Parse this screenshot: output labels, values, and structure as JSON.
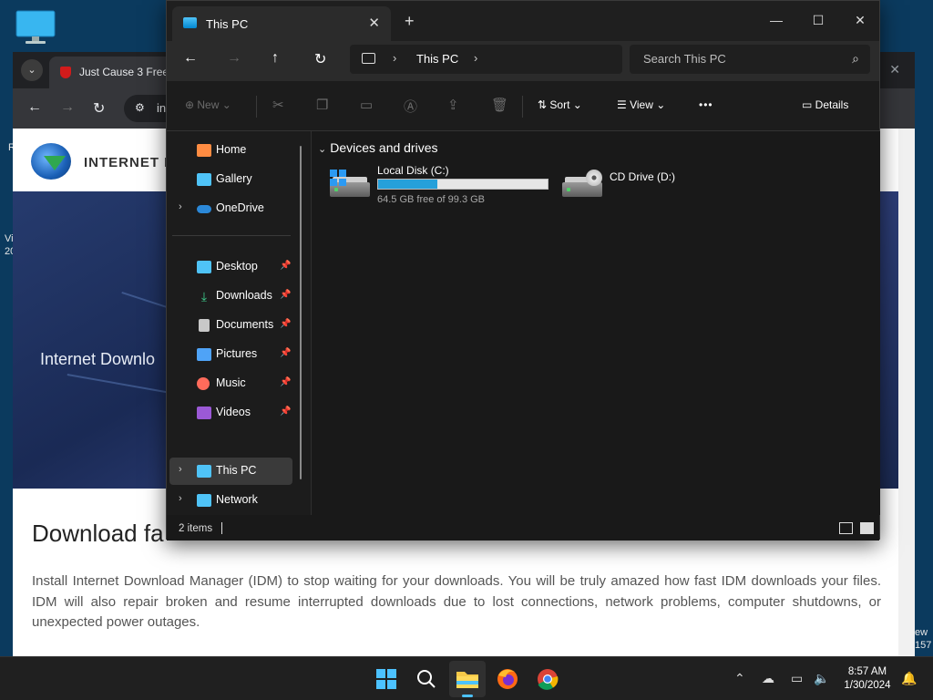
{
  "explorer": {
    "tab_title": "This PC",
    "tab_close": "✕",
    "new_tab": "+",
    "window_controls": {
      "minimize": "—",
      "maximize": "☐",
      "close": "✕"
    },
    "nav": {
      "back": "←",
      "forward": "→",
      "up": "↑",
      "refresh": "↻"
    },
    "address": {
      "sep1": "›",
      "location": "This PC",
      "sep2": "›"
    },
    "search": {
      "placeholder": "Search This PC",
      "icon": "⌕"
    },
    "commands": {
      "new": "New",
      "sort": "Sort",
      "view": "View",
      "more": "•••",
      "details": "Details",
      "icons": [
        "cut-icon",
        "copy-icon",
        "paste-icon",
        "rename-icon",
        "share-icon",
        "delete-icon"
      ]
    },
    "navigation": [
      {
        "label": "Home",
        "icon": "home-icon",
        "color": "#ff8c42"
      },
      {
        "label": "Gallery",
        "icon": "gallery-icon",
        "color": "#4fc3f7"
      },
      {
        "label": "OneDrive",
        "icon": "onedrive-icon",
        "color": "#2b88d8",
        "expandable": true
      },
      {
        "label": "Desktop",
        "icon": "desktop-icon",
        "color": "#4fc3f7",
        "pinned": true
      },
      {
        "label": "Downloads",
        "icon": "downloads-icon",
        "color": "#3ecf8e",
        "pinned": true
      },
      {
        "label": "Documents",
        "icon": "documents-icon",
        "color": "#c8c8c8",
        "pinned": true
      },
      {
        "label": "Pictures",
        "icon": "pictures-icon",
        "color": "#4fa3f7",
        "pinned": true
      },
      {
        "label": "Music",
        "icon": "music-icon",
        "color": "#ff6b5b",
        "pinned": true
      },
      {
        "label": "Videos",
        "icon": "videos-icon",
        "color": "#9b59d6",
        "pinned": true
      },
      {
        "label": "This PC",
        "icon": "this-pc-icon",
        "color": "#4fc3f7",
        "expandable": true,
        "selected": true
      },
      {
        "label": "Network",
        "icon": "network-icon",
        "color": "#4fc3f7",
        "expandable": true
      }
    ],
    "group_title": "Devices and drives",
    "drives": [
      {
        "name": "Local Disk (C:)",
        "free_text": "64.5 GB free of 99.3 GB",
        "used_fraction": 0.35
      },
      {
        "name": "CD Drive (D:)"
      }
    ],
    "status": "2 items"
  },
  "browser": {
    "tab_title": "Just Cause 3 Free",
    "url": "in",
    "site_name": "INTERNET D",
    "hero_text": "Internet Downlo",
    "heading": "Download fa",
    "body": "Install Internet Download Manager (IDM) to stop waiting for your downloads. You will be truly amazed how fast IDM downloads your files. IDM will also repair broken and resume interrupted downloads due to lost connections, network problems, computer shutdowns, or unexpected power outages."
  },
  "desktop": {
    "fragments": [
      "R",
      "Vi",
      "20",
      "ew",
      "157"
    ]
  },
  "taskbar": {
    "apps": [
      "start-icon",
      "search-icon",
      "file-explorer-icon",
      "firefox-icon",
      "chrome-icon"
    ],
    "time": "8:57 AM",
    "date": "1/30/2024"
  },
  "colors": {
    "accent": "#26a0da",
    "taskbar_indicator": "#4cc2ff"
  }
}
